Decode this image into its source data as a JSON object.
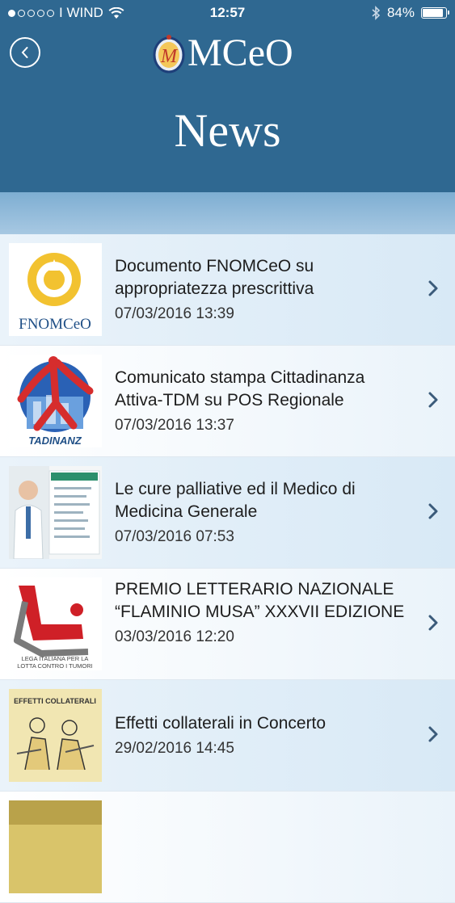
{
  "status_bar": {
    "carrier": "I WIND",
    "time": "12:57",
    "battery": "84%",
    "battery_level": 0.84
  },
  "header": {
    "logo_text": "MCeO",
    "logo_letter": "M",
    "title": "News"
  },
  "news": [
    {
      "title": "Documento FNOMCeO su appropriatezza prescrittiva",
      "date": "07/03/2016 13:39",
      "thumb_text": "FNOMCeO"
    },
    {
      "title": "Comunicato stampa Cittadinanza Attiva-TDM su POS Regionale",
      "date": "07/03/2016 13:37",
      "thumb_text": "TADINANZ"
    },
    {
      "title": "Le cure palliative ed il Medico di Medicina Generale",
      "date": "07/03/2016 07:53"
    },
    {
      "title": "PREMIO LETTERARIO NAZIONALE “FLAMINIO MUSA” XXXVII EDIZIONE",
      "date": "03/03/2016 12:20",
      "thumb_text_1": "LEGA ITALIANA PER LA",
      "thumb_text_2": "LOTTA CONTRO I TUMORI"
    },
    {
      "title": "Effetti collaterali in Concerto",
      "date": "29/02/2016 14:45",
      "thumb_text": "EFFETTI COLLATERALI"
    }
  ],
  "colors": {
    "header_bg": "#2f6891",
    "subband": "#8fb9da",
    "row_tint": "#e3eff8",
    "chevron": "#3b5b7a"
  }
}
